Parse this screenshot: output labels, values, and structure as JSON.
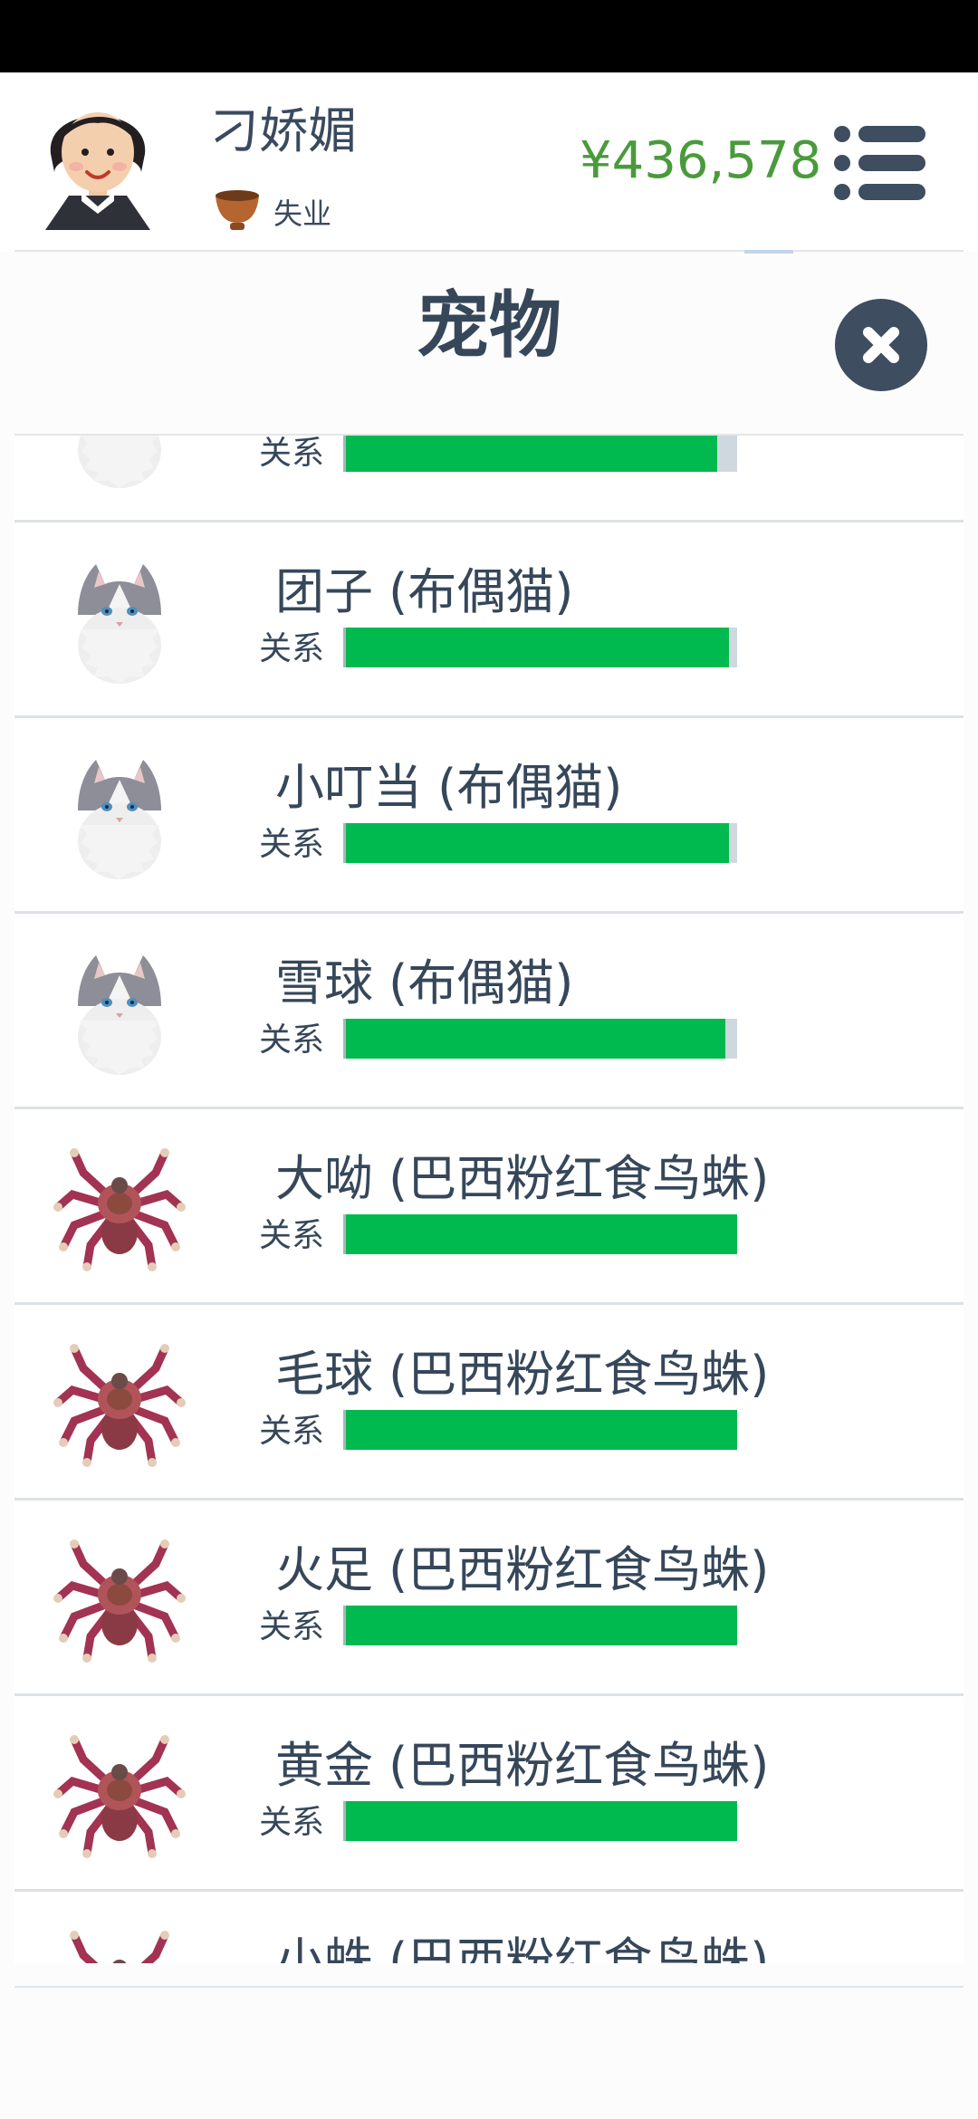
{
  "header": {
    "player_name": "刁娇媚",
    "job": "失业",
    "money": "¥436,578"
  },
  "panel": {
    "title": "宠物"
  },
  "pets": [
    {
      "name": "",
      "kind": "cat",
      "relation_label": "关系",
      "relation_level": 0.95
    },
    {
      "name": "团子 (布偶猫)",
      "kind": "cat",
      "relation_label": "关系",
      "relation_level": 0.98
    },
    {
      "name": "小叮当 (布偶猫)",
      "kind": "cat",
      "relation_label": "关系",
      "relation_level": 0.98
    },
    {
      "name": "雪球 (布偶猫)",
      "kind": "cat",
      "relation_label": "关系",
      "relation_level": 0.97
    },
    {
      "name": "大呦 (巴西粉红食鸟蛛)",
      "kind": "spider",
      "relation_label": "关系",
      "relation_level": 1.0
    },
    {
      "name": "毛球 (巴西粉红食鸟蛛)",
      "kind": "spider",
      "relation_label": "关系",
      "relation_level": 1.0
    },
    {
      "name": "火足 (巴西粉红食鸟蛛)",
      "kind": "spider",
      "relation_label": "关系",
      "relation_level": 1.0
    },
    {
      "name": "黄金 (巴西粉红食鸟蛛)",
      "kind": "spider",
      "relation_label": "关系",
      "relation_level": 1.0
    },
    {
      "name": "小蛛 (巴西粉红食鸟蛛)",
      "kind": "spider",
      "relation_label": "关系",
      "relation_level": 1.0
    }
  ],
  "icons": {
    "menu": "menu-icon",
    "close": "close-icon",
    "job": "bowl-icon",
    "cat": "ragdoll-cat-icon",
    "spider": "tarantula-icon"
  },
  "colors": {
    "money": "#4a9a3c",
    "relation_bar": "#00b94f",
    "title_text": "#36475a",
    "close_button": "#3e4d5f"
  }
}
